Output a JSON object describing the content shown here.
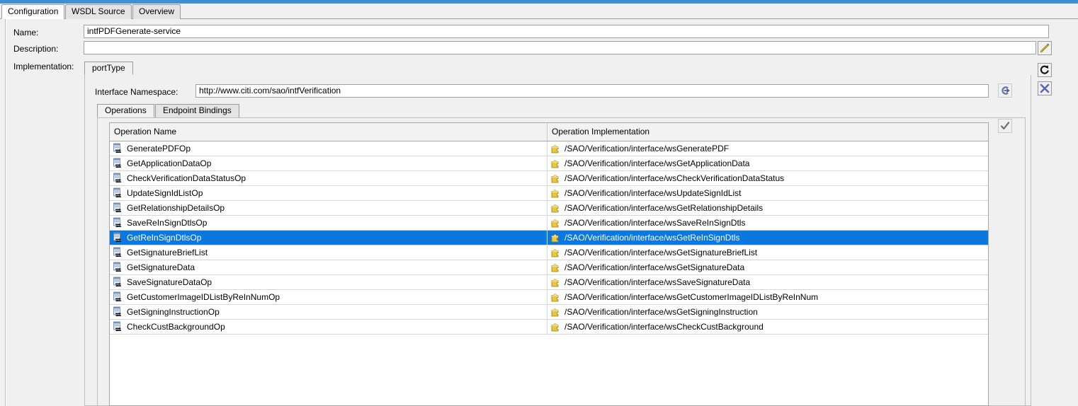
{
  "window": {
    "top_tabs": [
      {
        "label": "Configuration",
        "active": true
      },
      {
        "label": "WSDL Source",
        "active": false
      },
      {
        "label": "Overview",
        "active": false
      }
    ]
  },
  "form": {
    "name_label": "Name:",
    "name_value": "intfPDFGenerate-service",
    "description_label": "Description:",
    "description_value": "",
    "implementation_label": "Implementation:"
  },
  "side_buttons": [
    {
      "name": "edit-description-button",
      "icon": "pencil-icon"
    },
    {
      "name": "refresh-button",
      "icon": "refresh-icon"
    },
    {
      "name": "delete-button",
      "icon": "close-x-icon"
    }
  ],
  "implementation": {
    "tabs": [
      {
        "label": "portType",
        "active": true
      }
    ],
    "namespace_label": "Interface Namespace:",
    "namespace_value": "http://www.citi.com/sao/intfVerification",
    "namespace_button_icon": "namespace-edit-icon",
    "validate_button_icon": "checkmark-icon",
    "sub_tabs": [
      {
        "label": "Operations",
        "active": true
      },
      {
        "label": "Endpoint Bindings",
        "active": false
      }
    ]
  },
  "table": {
    "columns": [
      "Operation Name",
      "Operation Implementation"
    ],
    "row_icon_name": "operation-icon",
    "impl_icon_name": "puzzle-piece-icon",
    "selected_index": 6,
    "rows": [
      {
        "operation": "GeneratePDFOp",
        "implementation": "/SAO/Verification/interface/wsGeneratePDF"
      },
      {
        "operation": "GetApplicationDataOp",
        "implementation": "/SAO/Verification/interface/wsGetApplicationData"
      },
      {
        "operation": "CheckVerificationDataStatusOp",
        "implementation": "/SAO/Verification/interface/wsCheckVerificationDataStatus"
      },
      {
        "operation": "UpdateSignIdListOp",
        "implementation": "/SAO/Verification/interface/wsUpdateSignIdList"
      },
      {
        "operation": "GetRelationshipDetailsOp",
        "implementation": "/SAO/Verification/interface/wsGetRelationshipDetails"
      },
      {
        "operation": "SaveReInSignDtlsOp",
        "implementation": "/SAO/Verification/interface/wsSaveReInSignDtls"
      },
      {
        "operation": "GetReInSignDtlsOp",
        "implementation": "/SAO/Verification/interface/wsGetReInSignDtls"
      },
      {
        "operation": "GetSignatureBriefList",
        "implementation": "/SAO/Verification/interface/wsGetSignatureBriefList"
      },
      {
        "operation": "GetSignatureData",
        "implementation": "/SAO/Verification/interface/wsGetSignatureData"
      },
      {
        "operation": "SaveSignatureDataOp",
        "implementation": "/SAO/Verification/interface/wsSaveSignatureData"
      },
      {
        "operation": "GetCustomerImageIDListByReInNumOp",
        "implementation": "/SAO/Verification/interface/wsGetCustomerImageIDListByReInNum"
      },
      {
        "operation": "GetSigningInstructionOp",
        "implementation": "/SAO/Verification/interface/wsGetSigningInstruction"
      },
      {
        "operation": "CheckCustBackgroundOp",
        "implementation": "/SAO/Verification/interface/wsCheckCustBackground"
      }
    ]
  },
  "colors": {
    "top_strip": "#3f8fd2",
    "selection": "#0a78dc",
    "panel_bg": "#f0f0f0",
    "pencil": "#f2c80f",
    "puzzle": "#e8c23a",
    "x_icon": "#5b6ab0"
  }
}
